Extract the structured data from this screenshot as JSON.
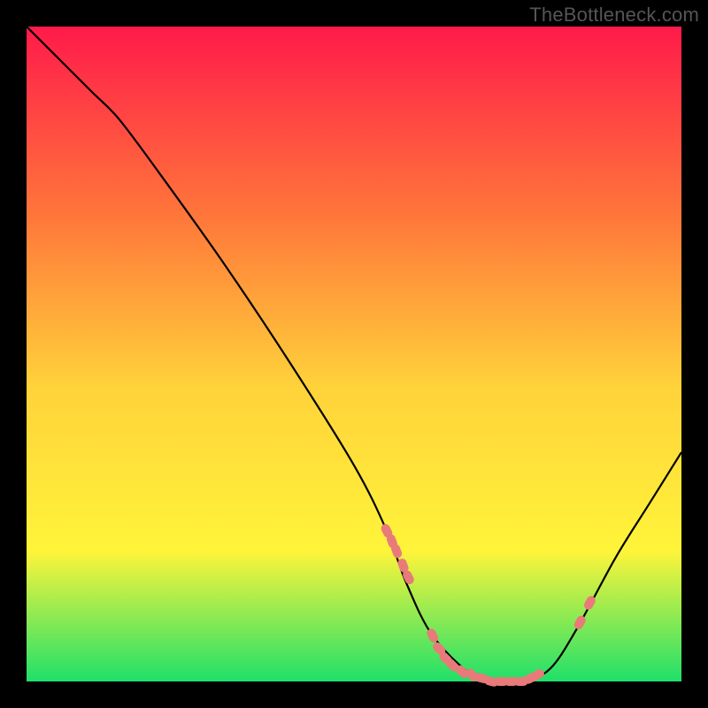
{
  "watermark": "TheBottleneck.com",
  "chart_data": {
    "type": "line",
    "title": "",
    "xlabel": "",
    "ylabel": "",
    "xlim": [
      0,
      100
    ],
    "ylim": [
      0,
      100
    ],
    "background_gradient": {
      "top": "#ff1a4a",
      "mid_upper": "#ff7a3a",
      "mid": "#ffd23a",
      "mid_lower": "#fff43a",
      "bottom": "#1fe06a"
    },
    "series": [
      {
        "name": "bottleneck-curve",
        "color": "#000000",
        "x": [
          0,
          5,
          10,
          14,
          20,
          30,
          40,
          50,
          55,
          58,
          62,
          68,
          72,
          76,
          80,
          84,
          90,
          95,
          100
        ],
        "y": [
          100,
          95,
          90,
          86,
          78,
          64,
          49,
          33,
          23,
          15,
          7,
          1,
          0,
          0,
          2,
          8,
          19,
          27,
          35
        ]
      }
    ],
    "markers": {
      "name": "highlight-points",
      "color": "#e97a7a",
      "points": [
        {
          "x": 55.0,
          "y": 23.0
        },
        {
          "x": 55.8,
          "y": 21.4
        },
        {
          "x": 56.5,
          "y": 19.9
        },
        {
          "x": 57.5,
          "y": 17.7
        },
        {
          "x": 58.3,
          "y": 15.9
        },
        {
          "x": 62.0,
          "y": 7.0
        },
        {
          "x": 63.0,
          "y": 5.0
        },
        {
          "x": 64.0,
          "y": 3.5
        },
        {
          "x": 65.0,
          "y": 2.5
        },
        {
          "x": 66.5,
          "y": 1.5
        },
        {
          "x": 68.0,
          "y": 1.0
        },
        {
          "x": 69.5,
          "y": 0.5
        },
        {
          "x": 71.0,
          "y": 0.0
        },
        {
          "x": 72.5,
          "y": 0.0
        },
        {
          "x": 74.0,
          "y": 0.0
        },
        {
          "x": 75.5,
          "y": 0.0
        },
        {
          "x": 77.0,
          "y": 0.5
        },
        {
          "x": 78.0,
          "y": 1.0
        },
        {
          "x": 84.5,
          "y": 9.0
        },
        {
          "x": 86.0,
          "y": 12.0
        }
      ]
    }
  }
}
